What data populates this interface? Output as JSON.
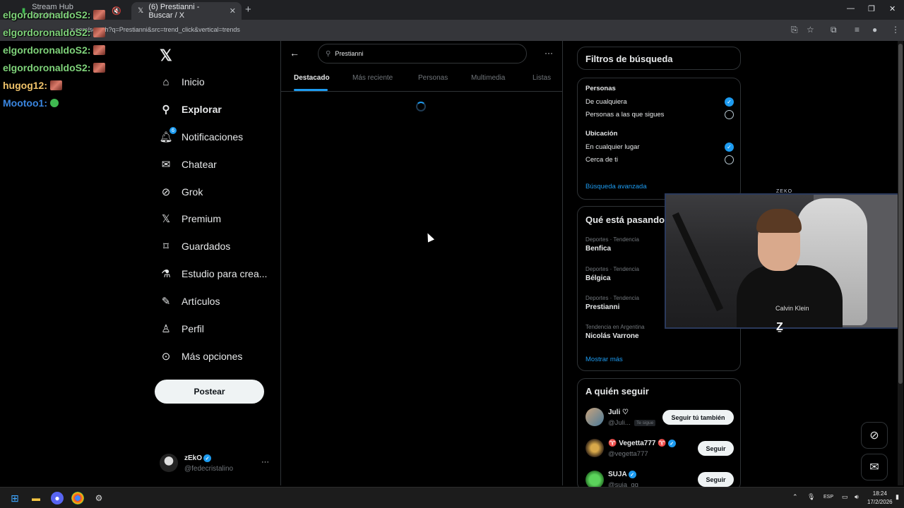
{
  "browser": {
    "tabs": [
      {
        "label": "Stream Hub Dashboard",
        "muted": true
      },
      {
        "label": "(6) Prestianni - Buscar / X",
        "active": true
      }
    ],
    "url": "x.com/search?q=Prestianni&src=trend_click&vertical=trends"
  },
  "chat": [
    {
      "user": "elgordoronaldoS2:",
      "color": "#7fd37a"
    },
    {
      "user": "elgordoronaldoS2:",
      "color": "#7fd37a"
    },
    {
      "user": "elgordoronaldoS2:",
      "color": "#7fd37a"
    },
    {
      "user": "elgordoronaldoS2:",
      "color": "#7fd37a"
    },
    {
      "user": "hugog12:",
      "color": "#f0c36a"
    },
    {
      "user": "Mootoo1:",
      "color": "#3a86e0"
    }
  ],
  "nav": {
    "items": [
      {
        "label": "Inicio"
      },
      {
        "label": "Explorar"
      },
      {
        "label": "Notificaciones",
        "badge": "6"
      },
      {
        "label": "Chatear"
      },
      {
        "label": "Grok"
      },
      {
        "label": "Premium"
      },
      {
        "label": "Guardados"
      },
      {
        "label": "Estudio para crea..."
      },
      {
        "label": "Artículos"
      },
      {
        "label": "Perfil"
      },
      {
        "label": "Más opciones"
      }
    ],
    "post_label": "Postear"
  },
  "profile": {
    "name": "zEkO",
    "handle": "@fedecristalino"
  },
  "search": {
    "query": "Prestianni",
    "tabs": [
      "Destacado",
      "Más reciente",
      "Personas",
      "Multimedia",
      "Listas"
    ]
  },
  "filters": {
    "title": "Filtros de búsqueda",
    "people_heading": "Personas",
    "people_options": [
      "De cualquiera",
      "Personas a las que sigues"
    ],
    "location_heading": "Ubicación",
    "location_options": [
      "En cualquier lugar",
      "Cerca de ti"
    ],
    "advanced_link": "Búsqueda avanzada"
  },
  "trends": {
    "title": "Qué está pasando",
    "items": [
      {
        "meta": "Deportes · Tendencia",
        "name": "Benfica"
      },
      {
        "meta": "Deportes · Tendencia",
        "name": "Bélgica"
      },
      {
        "meta": "Deportes · Tendencia",
        "name": "Prestianni"
      },
      {
        "meta": "Tendencia en Argentina",
        "name": "Nicolás Varrone"
      }
    ],
    "show_more": "Mostrar más"
  },
  "who_to_follow": {
    "title": "A quién seguir",
    "items": [
      {
        "name": "Juli ♡",
        "handle": "@Juli...",
        "follows_you": "Te sigue",
        "button": "Seguir tú también"
      },
      {
        "name": "♈ Vegetta777 ♈",
        "handle": "@vegetta777",
        "button": "Seguir"
      },
      {
        "name": "SUJA",
        "handle": "@suja_gg",
        "button": "Seguir"
      }
    ]
  },
  "webcam": {
    "label": "ZEKO",
    "shirt_text": "Calvin Klein"
  },
  "taskbar": {
    "lang": "ESP",
    "time": "18:24",
    "date": "17/2/2026"
  }
}
